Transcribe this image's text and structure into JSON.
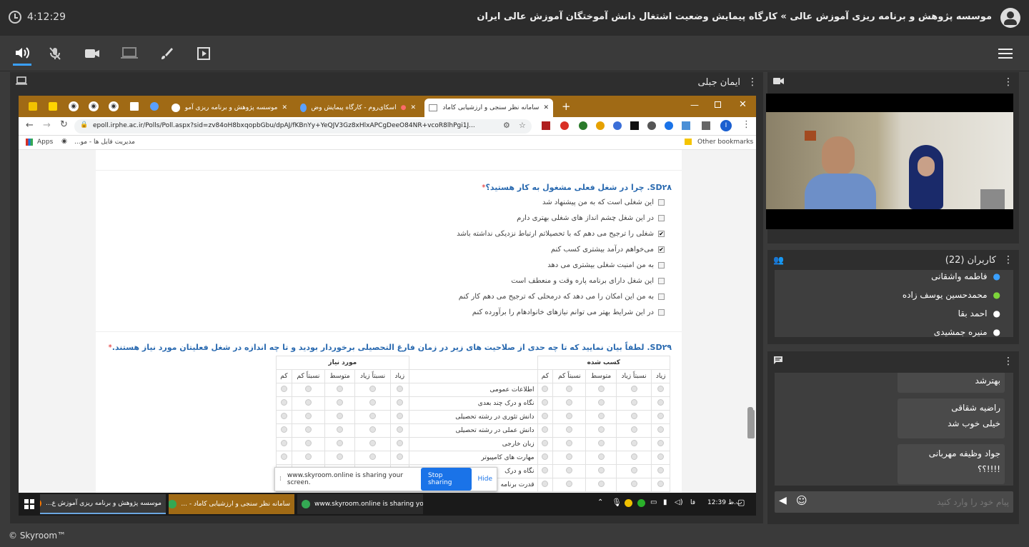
{
  "topbar": {
    "clock": "4:12:29",
    "title": "موسسه پژوهش و برنامه ریزی آموزش عالی » کارگاه پیمایش وضعیت اشتغال دانش آموختگان آموزش عالی ایران"
  },
  "share_panel": {
    "title": "ایمان جبلی"
  },
  "browser": {
    "tabs": [
      {
        "label": "موسسه پژوهش و برنامه ریزی آمو"
      },
      {
        "label": "اسکای‌روم - کارگاه پیمایش وض"
      },
      {
        "label": "سامانه نظر سنجی و ارزشیابی کاماد"
      }
    ],
    "url": "epoll.irphe.ac.ir/Polls/Poll.aspx?sid=zv84oH8bxqopbGbu/dpAJ/fKBnYy+YeQJV3Gz8xHlxAPCgDeeO84NR+vcoR8lhPgi1J...",
    "bookmarks": {
      "apps": "Apps",
      "item1": "مدیریت فایل ها - مو...",
      "other": "Other bookmarks"
    }
  },
  "q28": {
    "title": "SD۲۸. چرا در شغل فعلی مشغول به کار هستید؟",
    "required": "*",
    "options": [
      {
        "label": "این شغلی است که به من پیشنهاد شد",
        "checked": false
      },
      {
        "label": "در این شغل چشم انداز های شغلی بهتری دارم",
        "checked": false
      },
      {
        "label": "شغلی را ترجیح می دهم که با تحصیلاتم ارتباط نزدیکی نداشته باشد",
        "checked": true
      },
      {
        "label": "می‌خواهم درآمد بیشتری کسب کنم",
        "checked": true
      },
      {
        "label": "به من امنیت شغلی بیشتری می دهد",
        "checked": false
      },
      {
        "label": "این شغل دارای برنامه پاره وقت و منعطف است",
        "checked": false
      },
      {
        "label": "به من این امکان را می دهد که درمحلی که ترجیح می دهم کار کنم",
        "checked": false
      },
      {
        "label": "در این شرایط بهتر می توانم نیازهای خانوادهام را برآورده کنم",
        "checked": false
      }
    ]
  },
  "q29": {
    "title": "SD۲۹. لطفاً بیان نمایید که تا چه حدی از صلاحیت های زیر در زمان فارغ التحصیلی برخوردار بودید و تا چه اندازه در شغل فعلیتان مورد نیاز هستند.",
    "required": "*",
    "group_acquired": "کسب شده",
    "group_needed": "مورد نیاز",
    "scale": [
      "زیاد",
      "نسبتاً زیاد",
      "متوسط",
      "نسبتاً کم",
      "کم"
    ],
    "rows": [
      "اطلاعات عمومی",
      "نگاه و درک چند بعدی",
      "دانش تئوری در رشته تحصیلی",
      "دانش عملی در رشته تحصیلی",
      "زبان خارجی",
      "مهارت های کامپیوتر",
      "نگاه و درک",
      "قدرت برنامه"
    ]
  },
  "share_banner": {
    "text": "www.skyroom.online is sharing your screen.",
    "stop": "Stop sharing",
    "hide": "Hide"
  },
  "taskbar": {
    "items": [
      "موسسه پژوهش و برنامه ریزی آموزش ع...",
      "سامانه نظر سنجی و ارزشیابی کاماد - ...",
      "www.skyroom.online is sharing your..."
    ],
    "lang": "فا",
    "time": "12:39 ب.ظ"
  },
  "users": {
    "header": "کاربران (22)",
    "list": [
      {
        "name": "فاطمه واشقانی",
        "color": "#3aa0ff"
      },
      {
        "name": "محمدحسین یوسف زاده",
        "color": "#7cd43a"
      },
      {
        "name": "احمد بقا",
        "color": "#ffffff"
      },
      {
        "name": "منیره جمشیدی",
        "color": "#ffffff"
      }
    ]
  },
  "chat": {
    "messages": [
      {
        "author": "",
        "text": "بهترشد"
      },
      {
        "author": "راضیه شقاقی",
        "text": "خیلی خوب شد"
      },
      {
        "author": "جواد وظیفه مهربانی",
        "text": "!!!!؟؟"
      }
    ],
    "input_placeholder": "پیام خود را وارد کنید"
  },
  "footer": {
    "brand": "© Skyroom™"
  }
}
